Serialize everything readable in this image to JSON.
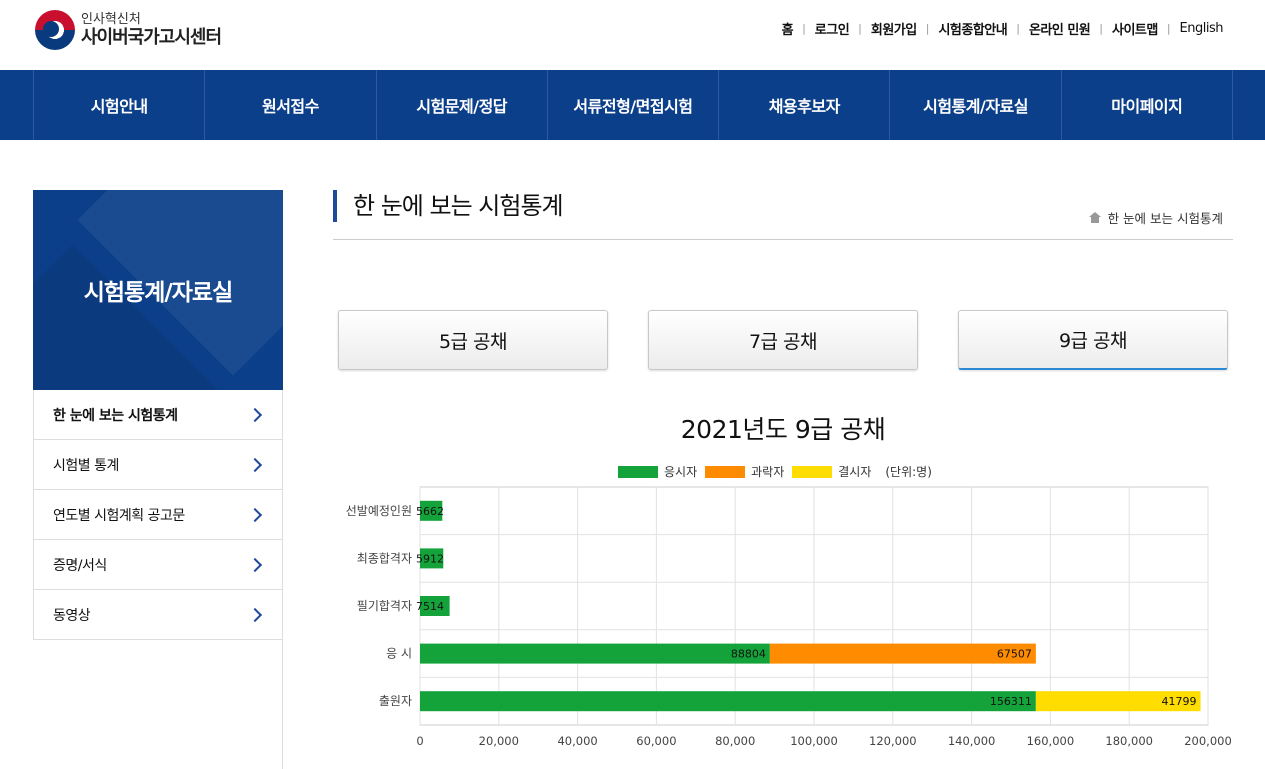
{
  "header": {
    "logo_top": "인사혁신처",
    "logo_main": "사이버국가고시센터",
    "utility_links": [
      "홈",
      "로그인",
      "회원가입",
      "시험종합안내",
      "온라인 민원",
      "사이트맵",
      "English"
    ]
  },
  "gnb": [
    "시험안내",
    "원서접수",
    "시험문제/정답",
    "서류전형/면접시험",
    "채용후보자",
    "시험통계/자료실",
    "마이페이지"
  ],
  "sidebar": {
    "title": "시험통계/자료실",
    "items": [
      {
        "label": "한 눈에 보는 시험통계"
      },
      {
        "label": "시험별 통계"
      },
      {
        "label": "연도별 시험계획 공고문"
      },
      {
        "label": "증명/서식"
      },
      {
        "label": "동영상"
      }
    ]
  },
  "content": {
    "title": "한 눈에 보는 시험통계",
    "breadcrumb": "한 눈에 보는 시험통계",
    "tabs": [
      "5급 공채",
      "7급 공채",
      "9급 공채"
    ],
    "active_tab": "9급 공채"
  },
  "legend": {
    "items": [
      {
        "label": "응시자",
        "color": "#13a33a"
      },
      {
        "label": "과락자",
        "color": "#ff8c00"
      },
      {
        "label": "결시자",
        "color": "#ffdd00"
      }
    ],
    "unit": "(단위:명)"
  },
  "chart_data": {
    "type": "bar",
    "orientation": "horizontal",
    "stacked": true,
    "title": "2021년도 9급 공채",
    "categories": [
      "선발예정인원",
      "최종합격자",
      "필기합격자",
      "응 시",
      "출원자"
    ],
    "series": [
      {
        "name": "응시자",
        "color": "#13a33a",
        "values": [
          5662,
          5912,
          7514,
          88804,
          156311
        ]
      },
      {
        "name": "과락자",
        "color": "#ff8c00",
        "values": [
          0,
          0,
          0,
          67507,
          0
        ]
      },
      {
        "name": "결시자",
        "color": "#ffdd00",
        "values": [
          0,
          0,
          0,
          0,
          41799
        ]
      }
    ],
    "xlim": [
      0,
      200000
    ],
    "xticks": [
      "0",
      "20,000",
      "40,000",
      "60,000",
      "80,000",
      "100,000",
      "120,000",
      "140,000",
      "160,000",
      "180,000",
      "200,000"
    ],
    "grid": true
  }
}
